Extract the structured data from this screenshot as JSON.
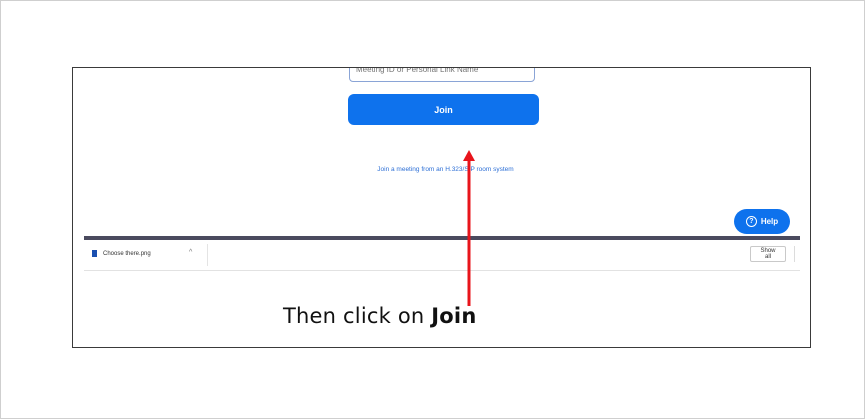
{
  "zoom": {
    "meeting_input_placeholder": "Meeting ID or Personal Link Name",
    "join_label": "Join",
    "h323_link": "Join a meeting from an H.323/SIP room system",
    "help_label": "Help",
    "help_icon": "question-circle-icon",
    "brand_color": "#0e72ed"
  },
  "downloads": {
    "file_name": "Choose there.png",
    "file_icon": "file-icon",
    "expand_icon": "chevron-up-icon",
    "show_all_label": "Show all"
  },
  "annotation": {
    "caption_prefix": "Then click on ",
    "caption_emphasis": "Join",
    "arrow_color": "#e8141b"
  }
}
